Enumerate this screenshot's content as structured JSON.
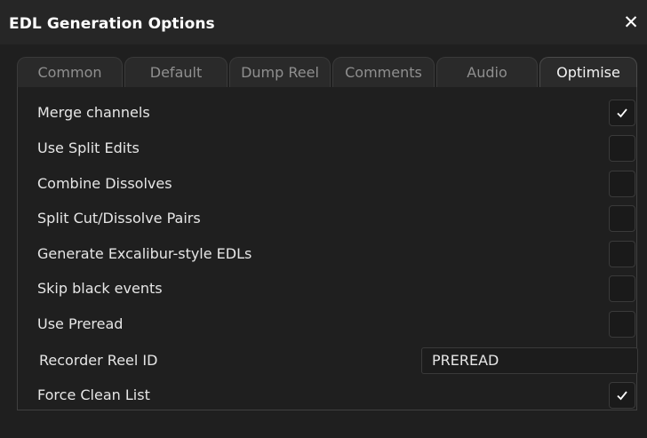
{
  "dialog": {
    "title": "EDL Generation Options",
    "close_icon": "close-icon"
  },
  "tabs": [
    {
      "label": "Common",
      "active": false
    },
    {
      "label": "Default",
      "active": false
    },
    {
      "label": "Dump Reel",
      "active": false
    },
    {
      "label": "Comments",
      "active": false
    },
    {
      "label": "Audio",
      "active": false
    },
    {
      "label": "Optimise",
      "active": true
    }
  ],
  "options": [
    {
      "label": "Merge channels",
      "checked": true
    },
    {
      "label": "Use Split Edits",
      "checked": false
    },
    {
      "label": "Combine Dissolves",
      "checked": false
    },
    {
      "label": "Split Cut/Dissolve Pairs",
      "checked": false
    },
    {
      "label": "Generate Excalibur-style EDLs",
      "checked": false
    },
    {
      "label": "Skip black events",
      "checked": false
    },
    {
      "label": "Use Preread",
      "checked": false
    }
  ],
  "recorder_reel": {
    "label": "Recorder Reel ID",
    "value": "PREREAD"
  },
  "force_clean": {
    "label": "Force Clean List",
    "checked": true
  },
  "colors": {
    "background": "#1f1f1f",
    "active_tab_text": "#f2f2f2",
    "inactive_tab_text": "#8f8f8f",
    "check_mark": "#ffffff"
  }
}
